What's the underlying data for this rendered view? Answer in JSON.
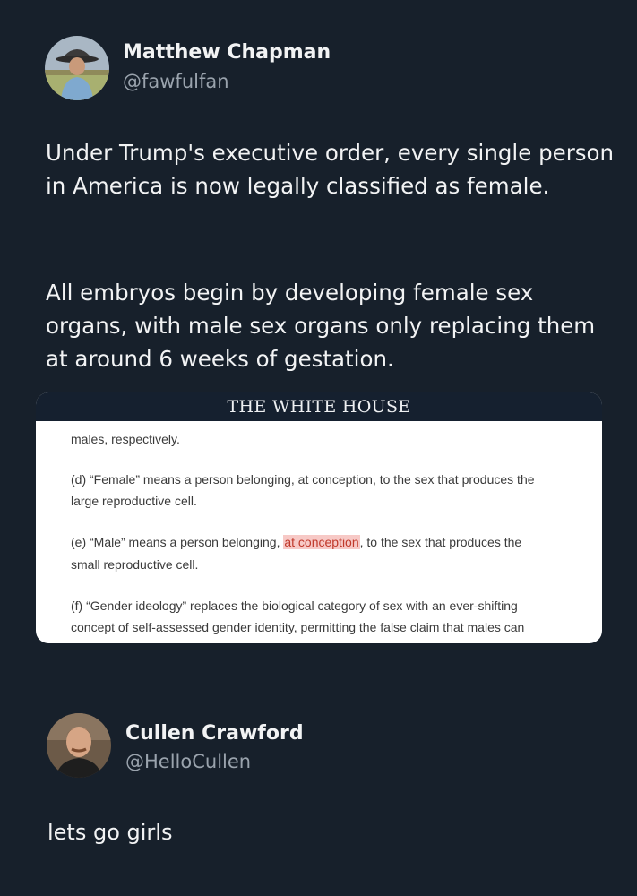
{
  "tweet": {
    "author_name": "Matthew Chapman",
    "author_handle": "@fawfulfan",
    "paragraphs": [
      "Under Trump's executive order, every single person in America is now legally classified as female.",
      "All embryos begin by developing female sex organs, with male sex organs only replacing them at around 6 weeks of gestation."
    ],
    "embed": {
      "header": "THE WHITE HOUSE",
      "lines": [
        "males, respectively.",
        "(d)  “Female” means a person belonging, at conception, to the sex that produces the",
        "large reproductive cell.",
        "(e)  “Male” means a person belonging, ",
        "at conception",
        ", to the sex that produces the",
        "small reproductive cell.",
        "(f)  “Gender ideology” replaces the biological category of sex with an ever-shifting",
        "concept of self-assessed gender identity, permitting the false claim that males can"
      ]
    }
  },
  "reply": {
    "author_name": "Cullen Crawford",
    "author_handle": "@HelloCullen",
    "text": "lets go girls"
  },
  "colors": {
    "background": "#17202b",
    "highlight_bg": "#f7c9c6",
    "highlight_text": "#c0392b"
  },
  "icons": [
    "avatar-matthew-chapman",
    "avatar-cullen-crawford"
  ]
}
